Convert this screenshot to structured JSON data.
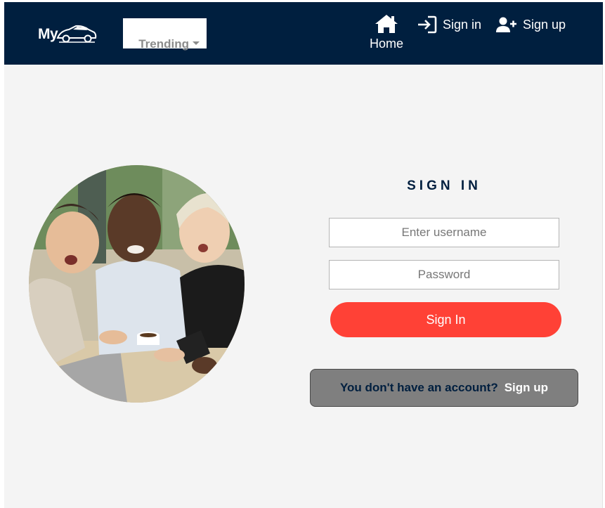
{
  "navbar": {
    "logo_text": "My",
    "trending_label": "Trending",
    "home_label": "Home",
    "signin_label": "Sign in",
    "signup_label": "Sign up"
  },
  "form": {
    "title": "SIGN IN",
    "username_placeholder": "Enter username",
    "password_placeholder": "Password",
    "submit_label": "Sign In",
    "no_account_text": "You don't have an account?",
    "signup_link": "Sign up"
  },
  "colors": {
    "navbar_bg": "#001f3f",
    "page_bg": "#f4f4f4",
    "primary_button": "#ff4136",
    "signup_box_bg": "#7f7f7f",
    "title_color": "#001f3f"
  },
  "icons": {
    "logo": "car-logo-icon",
    "trending_caret": "caret-down-icon",
    "home": "home-icon",
    "signin": "sign-in-icon",
    "signup": "user-plus-icon"
  }
}
